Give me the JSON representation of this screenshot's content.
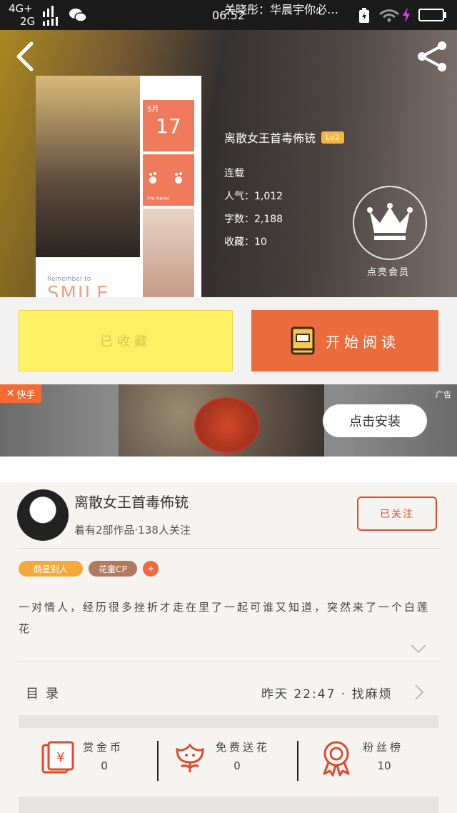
{
  "status_bar": {
    "network_top": "4G+",
    "network_bottom": "2G",
    "time": "06:52"
  },
  "book": {
    "title": "关晓彤：华晨宇你必…",
    "author": "离散女王首毒佈铳",
    "level": "Lv2",
    "status": "连载",
    "stats": [
      {
        "label": "人气：",
        "value": "1,012"
      },
      {
        "label": "字数：",
        "value": "2,188"
      },
      {
        "label": "收藏：",
        "value": "10"
      }
    ],
    "cover": {
      "month": "5月",
      "day": "17",
      "im_here": "I'm here!",
      "remember": "Remember to",
      "smile": "SMILE"
    },
    "crown_label": "点亮会员"
  },
  "actions": {
    "added_label": "已收藏",
    "read_label": "开始阅读"
  },
  "ad": {
    "brand": "快手",
    "tag": "广告",
    "install_label": "点击安装"
  },
  "author_card": {
    "name": "离散女王首毒佈铳",
    "subtitle": "着有2部作品·138人关注",
    "follow_label": "已关注"
  },
  "tags": [
    "萌星别人",
    "花童CP",
    "+"
  ],
  "description": "一对情人，经历很多挫折才走在里了一起可谁又知道，突然来了一个白莲花",
  "toc": {
    "label": "目录",
    "updated": "昨天 22:47 · 找麻烦"
  },
  "rewards": [
    {
      "label": "赏金币",
      "value": "0",
      "icon": "red-envelope-icon"
    },
    {
      "label": "免费送花",
      "value": "0",
      "icon": "flower-icon"
    },
    {
      "label": "粉丝榜",
      "value": "10",
      "icon": "medal-icon"
    }
  ],
  "colors": {
    "accent": "#ec6b3d",
    "added_bg": "#fff066",
    "level_badge": "#f6b63f",
    "tag1": "#f6a93b",
    "tag2": "#b07a5e",
    "tag3": "#ec6b3d"
  }
}
